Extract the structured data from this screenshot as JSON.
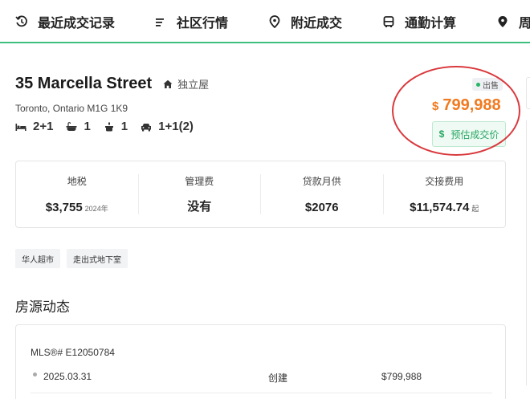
{
  "nav": {
    "items": [
      {
        "label": "最近成交记录",
        "icon": "history-icon"
      },
      {
        "label": "社区行情",
        "icon": "list-icon"
      },
      {
        "label": "附近成交",
        "icon": "location-pin-icon"
      },
      {
        "label": "通勤计算",
        "icon": "bus-icon"
      },
      {
        "label": "周",
        "icon": "location-pin-icon"
      }
    ]
  },
  "listing": {
    "street": "35 Marcella Street",
    "property_type": "独立屋",
    "city_line": "Toronto, Ontario M1G 1K9",
    "features": {
      "bedrooms": "2+1",
      "bathrooms": "1",
      "kitchens": "1",
      "parking": "1+1(2)"
    },
    "status": "出售",
    "price_currency": "$",
    "price": "799,988",
    "estimate_button_icon": "$",
    "estimate_button_label": "预估成交价"
  },
  "costs": [
    {
      "label": "地税",
      "value": "$3,755",
      "suffix": "2024年"
    },
    {
      "label": "管理费",
      "value": "没有",
      "suffix": ""
    },
    {
      "label": "贷款月供",
      "value": "$2076",
      "suffix": ""
    },
    {
      "label": "交接费用",
      "value": "$11,574.74",
      "suffix": "起"
    }
  ],
  "tags": [
    "华人超市",
    "走出式地下室"
  ],
  "history": {
    "section_title": "房源动态",
    "mls": "MLS®# E12050784",
    "rows": [
      {
        "date": "2025.03.31",
        "event": "创建",
        "amount": "$799,988"
      }
    ]
  },
  "colors": {
    "accent_green": "#3fbf7f",
    "price_orange": "#f07a1f",
    "annotation_red": "#d9393d"
  }
}
